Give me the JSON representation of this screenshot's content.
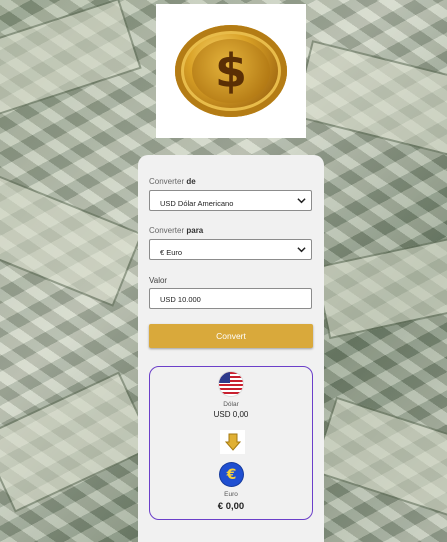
{
  "colors": {
    "accent": "#d9a93b",
    "result_border": "#6b3fc9",
    "card": "#f1f1f1"
  },
  "logo": {
    "icon": "gold-dollar-coin-icon"
  },
  "form": {
    "from_label_prefix": "Converter ",
    "from_label_bold": "de",
    "from_value": "USD Dólar Americano",
    "to_label_prefix": "Converter ",
    "to_label_bold": "para",
    "to_value": "€ Euro",
    "amount_label": "Valor",
    "amount_value": "USD 10.000",
    "convert_label": "Convert"
  },
  "result": {
    "from_currency_name": "Dólar",
    "from_currency_value": "USD 0,00",
    "to_currency_name": "Euro",
    "to_currency_value": "€ 0,00",
    "from_icon": "us-flag-icon",
    "arrow_icon": "down-arrow-icon",
    "to_icon": "euro-coin-icon"
  }
}
